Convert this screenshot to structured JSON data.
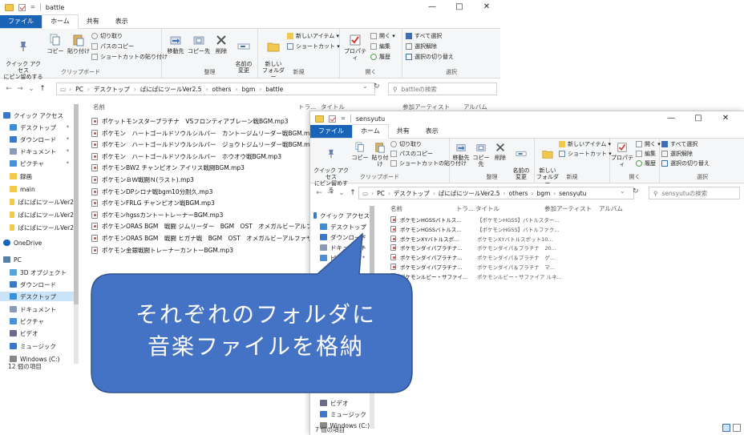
{
  "win1": {
    "qat_symbol": "=",
    "title": "battle",
    "controls": {
      "minimize": "—",
      "maximize": "□",
      "close": "✕"
    },
    "tabs": [
      "ファイル",
      "ホーム",
      "共有",
      "表示"
    ],
    "ribbon": {
      "pin_label": "クイック アクセス\nにピン留めする",
      "copy": "コピー",
      "paste": "貼り付け",
      "cut": "切り取り",
      "copy_path": "パスのコピー",
      "paste_shortcut": "ショートカットの貼り付け",
      "clipboard_group": "クリップボード",
      "move_to": "移動先",
      "copy_to": "コピー先",
      "delete": "削除",
      "rename": "名前の\n変更",
      "organize_group": "整理",
      "new_folder": "新しい\nフォルダー",
      "new_item": "新しいアイテム ▾",
      "shortcut": "ショートカット ▾",
      "new_group": "新規",
      "properties": "プロパティ",
      "open": "開く ▾",
      "edit": "編集",
      "history": "履歴",
      "open_group": "開く",
      "select_all": "すべて選択",
      "select_none": "選択解除",
      "invert": "選択の切り替え",
      "select_group": "選択"
    },
    "address": {
      "segments": [
        "PC",
        "デスクトップ",
        "ぱにぱにツールVer2.5",
        "others",
        "bgm",
        "battle"
      ],
      "search_placeholder": "battleの検索"
    },
    "nav": [
      {
        "label": "クイック アクセス",
        "icon": "star-icon"
      },
      {
        "label": "デスクトップ",
        "icon": "desktop-icon"
      },
      {
        "label": "ダウンロード",
        "icon": "download-icon"
      },
      {
        "label": "ドキュメント",
        "icon": "document-icon"
      },
      {
        "label": "ピクチャ",
        "icon": "picture-icon"
      },
      {
        "label": "録画",
        "icon": "folder-icon"
      },
      {
        "label": "main",
        "icon": "folder-icon"
      },
      {
        "label": "ぱにぱにツールVer2",
        "icon": "folder-icon"
      },
      {
        "label": "ぱにぱにツールVer2",
        "icon": "folder-icon"
      },
      {
        "label": "ぱにぱにツールVer2",
        "icon": "folder-icon"
      },
      {
        "label": "OneDrive",
        "icon": "cloud-icon"
      },
      {
        "label": "PC",
        "icon": "pc-icon"
      },
      {
        "label": "3D オブジェクト",
        "icon": "cube-icon"
      },
      {
        "label": "ダウンロード",
        "icon": "download-icon"
      },
      {
        "label": "デスクトップ",
        "icon": "desktop-icon"
      },
      {
        "label": "ドキュメント",
        "icon": "document-icon"
      },
      {
        "label": "ピクチャ",
        "icon": "picture-icon"
      },
      {
        "label": "ビデオ",
        "icon": "video-icon"
      },
      {
        "label": "ミュージック",
        "icon": "music-icon"
      },
      {
        "label": "Windows (C:)",
        "icon": "drive-icon"
      }
    ],
    "columns": [
      "名前",
      "トラ...",
      "タイトル",
      "参加アーティスト",
      "アルバム"
    ],
    "files": [
      "ポケットモンスタープラチナ　VSフロンティアブレーン戦BGM.mp3",
      "ポケモン　ハートゴールドソウルシルバー　カントージムリーダー戦BGM.mp3",
      "ポケモン　ハートゴールドソウルシルバー　ジョウトジムリーダー戦BGM.mp3",
      "ポケモン　ハートゴールドソウルシルバー　ホウオウ戦BGM.mp3",
      "ポケモンBW2 チャンピオン アイリス戦闘BGM.mp3",
      "ポケモンＢＷ戦闘Ｎ(ラスト).mp3",
      "ポケモンDPシロナ戦bgm10分耐久.mp3",
      "ポケモンFRLG チャンピオン戦BGM.mp3",
      "ポケモンhgssカントートレーナーBGM.mp3",
      "ポケモンORAS BGM　戦闘 ジムリーダー　BGM　OST　オメガルビーアルファ...",
      "ポケモンORAS BGM　戦闘 ヒガナ戦　BGM　OST　オメガルビーアルファサ...",
      "ポケモン金銀戦闘トレーナーカントーBGM.mp3"
    ],
    "status": "12 個の項目"
  },
  "win2": {
    "qat_symbol": "=",
    "title": "sensyutu",
    "controls": {
      "minimize": "—",
      "maximize": "□",
      "close": "✕"
    },
    "tabs": [
      "ファイル",
      "ホーム",
      "共有",
      "表示"
    ],
    "address": {
      "segments": [
        "PC",
        "デスクトップ",
        "ぱにぱにツールVer2.5",
        "others",
        "bgm",
        "sensyutu"
      ],
      "search_placeholder": "sensyutuの検索"
    },
    "nav": [
      {
        "label": "クイック アクセス",
        "icon": "star-icon"
      },
      {
        "label": "デスクトップ",
        "icon": "desktop-icon"
      },
      {
        "label": "ダウンロード",
        "icon": "download-icon"
      },
      {
        "label": "ドキュメント",
        "icon": "document-icon"
      },
      {
        "label": "ピクチャ",
        "icon": "picture-icon"
      },
      {
        "label": "ビデオ",
        "icon": "video-icon"
      },
      {
        "label": "ミュージック",
        "icon": "music-icon"
      },
      {
        "label": "Windows (C:)",
        "icon": "drive-icon"
      }
    ],
    "columns": [
      "名前",
      "トラ...",
      "タイトル",
      "参加アーティスト",
      "アルバム"
    ],
    "files": [
      {
        "name": "ポケモンHGSSバトルス...",
        "title": "【ポケモンHGSS】バトルスター..."
      },
      {
        "name": "ポケモンHGSSバトルス...",
        "title": "【ポケモンHGSS】バトルファク..."
      },
      {
        "name": "ポケモンXYバトルスポ...",
        "title": "ポケモンXYバトルスポット10..."
      },
      {
        "name": "ポケモンダイパプラチナ...",
        "title": "ポケモンダイパ＆プラチナ　20..."
      },
      {
        "name": "ポケモンダイパプラチナ...",
        "title": "ポケモンダイパ＆プラチナ　ゲ..."
      },
      {
        "name": "ポケモンダイパプラチナ...",
        "title": "ポケモンダイパ＆プラチナ　マ..."
      },
      {
        "name": "ポケモンルビー・サファイ...",
        "title": "ポケモンルビー・サファイア ルネ..."
      }
    ],
    "status": "7 個の項目"
  },
  "callout": {
    "line1": "それぞれのフォルダに",
    "line2": "音楽ファイルを格納",
    "fill": "#4472c4",
    "stroke": "#2f528f"
  }
}
